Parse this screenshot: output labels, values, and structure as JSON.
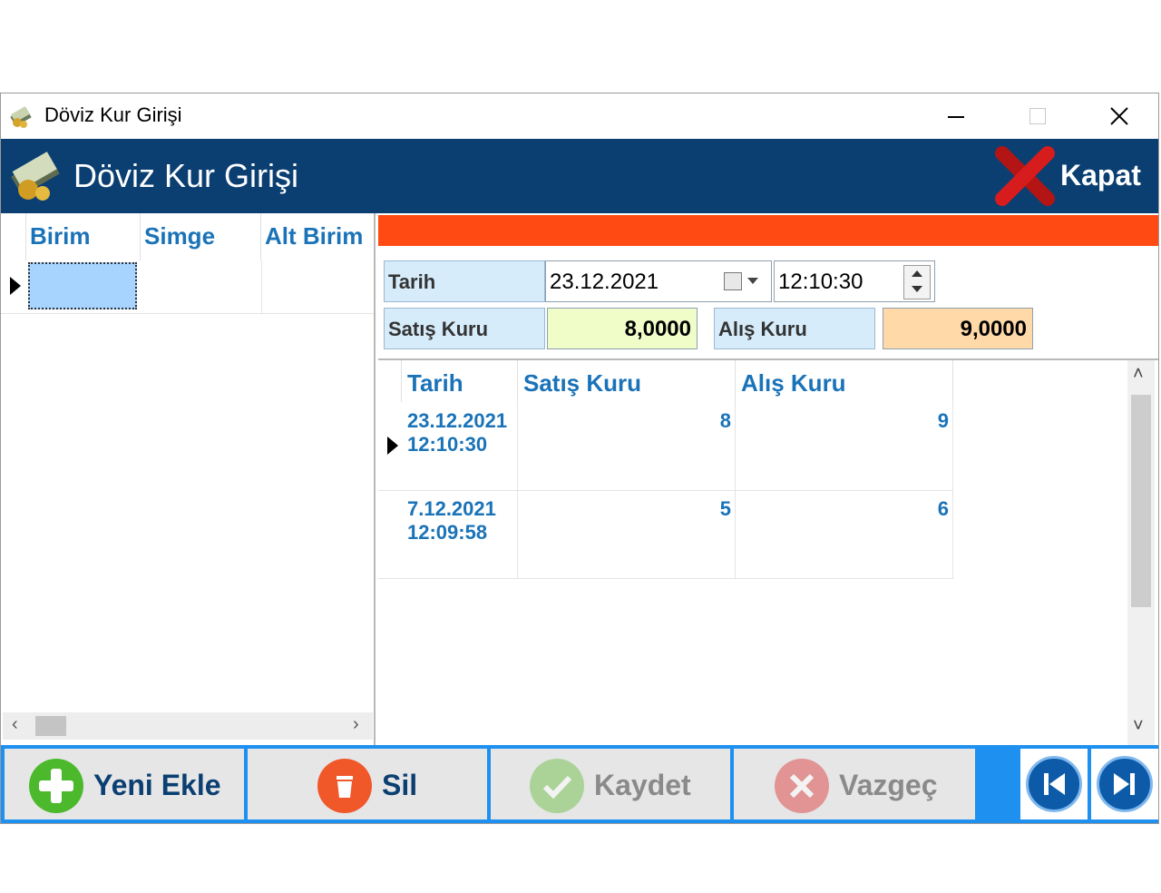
{
  "window": {
    "title": "Döviz Kur Girişi"
  },
  "header": {
    "title": "Döviz Kur Girişi",
    "close_label": "Kapat"
  },
  "left_grid": {
    "columns": [
      "Birim",
      "Simge",
      "Alt Birim"
    ]
  },
  "form": {
    "tarih_label": "Tarih",
    "tarih_value": "23.12.2021",
    "time_value": "12:10:30",
    "satis_label": "Satış Kuru",
    "satis_value": "8,0000",
    "alis_label": "Alış Kuru",
    "alis_value": "9,0000"
  },
  "rate_grid": {
    "columns": [
      "Tarih",
      "Satış Kuru",
      "Alış Kuru"
    ],
    "rows": [
      {
        "date": "23.12.2021",
        "time": "12:10:30",
        "satis": "8",
        "alis": "9"
      },
      {
        "date": "7.12.2021",
        "time": "12:09:58",
        "satis": "5",
        "alis": "6"
      }
    ]
  },
  "bottom": {
    "new_label": "Yeni Ekle",
    "delete_label": "Sil",
    "save_label": "Kaydet",
    "cancel_label": "Vazgeç"
  },
  "colors": {
    "header_bg": "#0b3f72",
    "accent_orange": "#ff4a14",
    "bottom_bar": "#1e90f0",
    "satis_bg": "#f0fdc8",
    "alis_bg": "#ffd9a8",
    "label_bg": "#d6ecfb",
    "grid_text": "#1a73b8"
  },
  "icons": {
    "app": "money-stack-icon",
    "close": "red-x-icon",
    "new": "green-plus-icon",
    "delete": "trash-icon",
    "save": "checkmark-icon",
    "cancel": "cancel-x-icon",
    "first": "first-record-icon",
    "last": "last-record-icon"
  }
}
